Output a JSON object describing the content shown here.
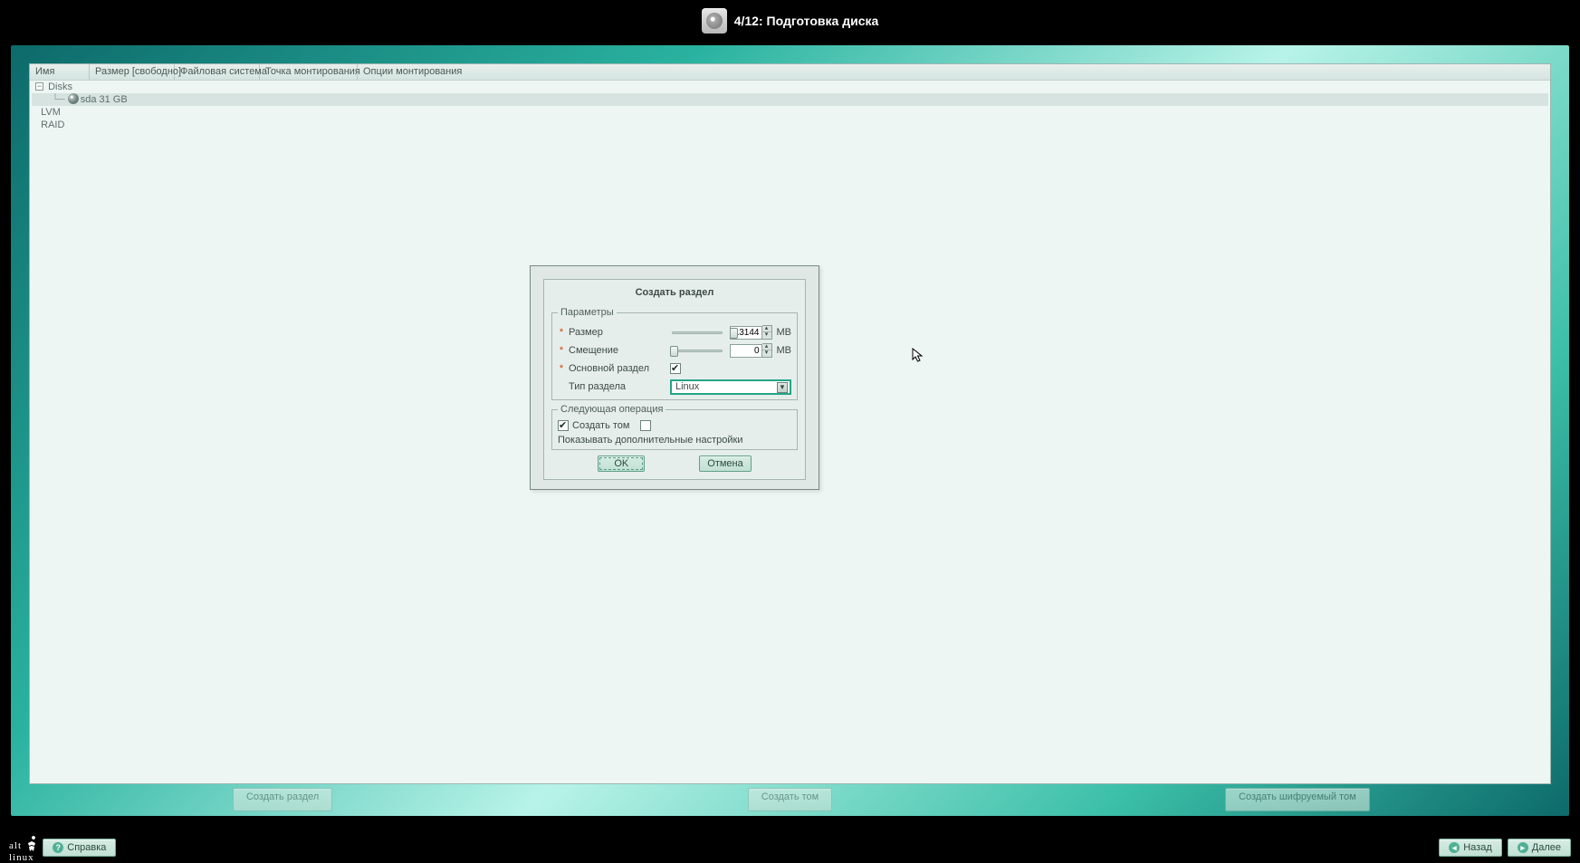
{
  "header": {
    "title": "4/12: Подготовка диска"
  },
  "columns": [
    "Имя",
    "Размер [свободно]",
    "Файловая система",
    "Точка монтирования",
    "Опции монтирования"
  ],
  "tree": {
    "disks_label": "Disks",
    "disk_entry": "sda  31 GB",
    "lvm_label": "LVM",
    "raid_label": "RAID"
  },
  "frame_buttons": {
    "create_partition": "Создать раздел",
    "create_volume": "Создать том",
    "create_encrypted": "Создать шифруемый том"
  },
  "dialog": {
    "title": "Создать раздел",
    "params_legend": "Параметры",
    "size_label": "Размер",
    "size_value": "13144",
    "offset_label": "Смещение",
    "offset_value": "0",
    "unit": "MB",
    "primary_label": "Основной раздел",
    "type_label": "Тип раздела",
    "type_value": "Linux",
    "next_legend": "Следующая операция",
    "create_volume_label": "Создать том",
    "show_advanced_label": "Показывать дополнительные настройки",
    "ok": "OK",
    "cancel": "Отмена"
  },
  "footer": {
    "help": "Справка",
    "back": "Назад",
    "next": "Далее",
    "logo_top": "alt",
    "logo_bottom": "linux"
  }
}
